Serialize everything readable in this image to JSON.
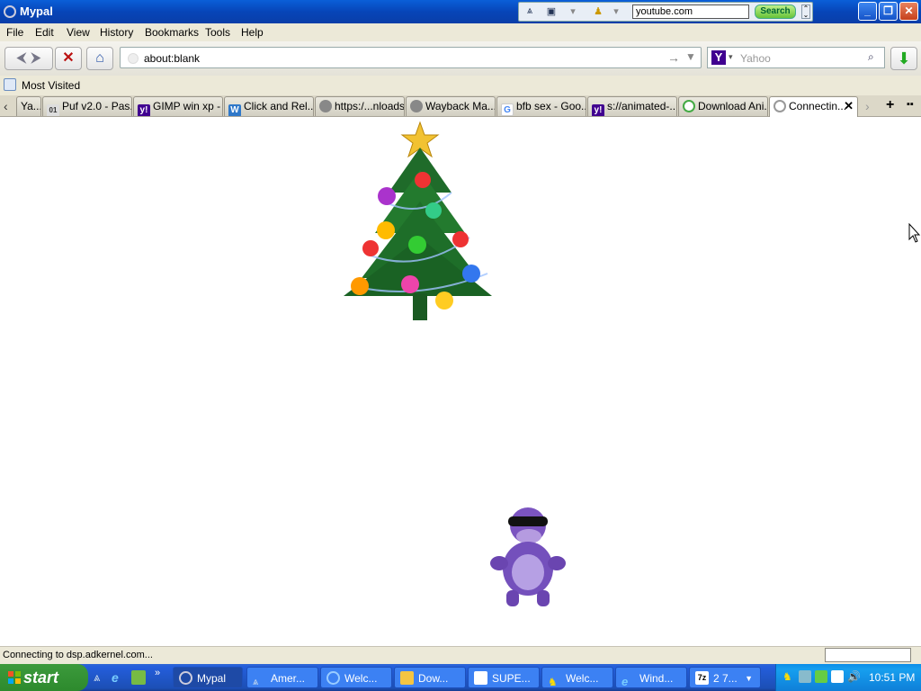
{
  "window": {
    "title": "Mypal",
    "minimize": "_",
    "restore": "❐",
    "close": "✕"
  },
  "toolbar_search": {
    "query": "youtube.com",
    "button": "Search"
  },
  "menu": {
    "items": [
      "File",
      "Edit",
      "View",
      "History",
      "Bookmarks",
      "Tools",
      "Help"
    ]
  },
  "nav": {
    "url": "about:blank",
    "search_engine": "Yahoo",
    "search_placeholder": "Yahoo"
  },
  "bookmarks": {
    "label": "Most Visited"
  },
  "tabs": [
    {
      "label": "Ya..."
    },
    {
      "label": "Puf v2.0 - Pas..."
    },
    {
      "label": "GIMP win xp - ..."
    },
    {
      "label": "Click and Rel..."
    },
    {
      "label": "https:/...nloads/"
    },
    {
      "label": "Wayback Ma..."
    },
    {
      "label": "bfb sex - Goo..."
    },
    {
      "label": "s://animated-..."
    },
    {
      "label": "Download Ani..."
    },
    {
      "label": "Connectin..."
    }
  ],
  "status": {
    "text": "Connecting to dsp.adkernel.com..."
  },
  "taskbar": {
    "start": "start",
    "tasks": [
      {
        "label": "Mypal"
      },
      {
        "label": "Amer..."
      },
      {
        "label": "Welc..."
      },
      {
        "label": "Dow..."
      },
      {
        "label": "SUPE..."
      },
      {
        "label": "Welc..."
      },
      {
        "label": "Wind..."
      },
      {
        "label": "2 7..."
      }
    ],
    "clock": "10:51 PM"
  },
  "colors": {
    "titlebar": "#0745b8",
    "taskbar": "#245edc",
    "start": "#2d8a2d",
    "yahoo": "#400090"
  }
}
